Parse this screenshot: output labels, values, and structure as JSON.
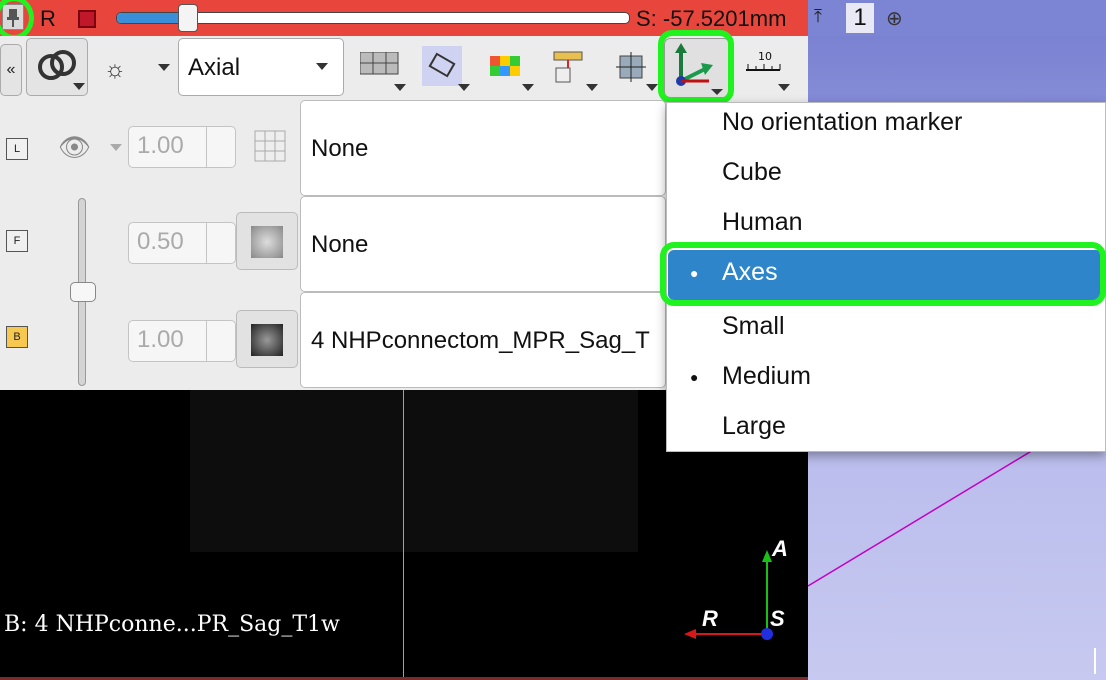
{
  "slice_bar": {
    "view_letter": "R",
    "offset_label": "S: -57.5201mm",
    "slider_position": 0.14,
    "color": "#e8463c"
  },
  "view3d_bar": {
    "view_number": "1",
    "color": "#7c85d4"
  },
  "toolbar": {
    "collapse_label": "«",
    "orientation_value": "Axial",
    "icons": [
      "link-icon",
      "visibility-icon",
      "layout-icon",
      "roi-icon",
      "lut-icon",
      "ruler-icon",
      "crosshair-icon",
      "orientation-marker-icon",
      "ruler-scale-icon"
    ]
  },
  "layers": {
    "label": {
      "badge": "L",
      "opacity": "1.00",
      "volume": "None"
    },
    "foreground": {
      "badge": "F",
      "opacity": "0.50",
      "volume": "None"
    },
    "background": {
      "badge": "B",
      "opacity": "1.00",
      "volume": "4 NHPconnectom_MPR_Sag_T"
    }
  },
  "slice_view": {
    "volume_caption": "B: 4 NHPconne...PR_Sag_T1w",
    "marker_labels": {
      "anterior": "A",
      "right": "R",
      "superior": "S"
    }
  },
  "orientation_menu": {
    "items": [
      {
        "label": "No orientation marker",
        "bullet": ""
      },
      {
        "label": "Cube",
        "bullet": ""
      },
      {
        "label": "Human",
        "bullet": ""
      },
      {
        "label": "Axes",
        "bullet": "●"
      },
      {
        "label": "Small",
        "bullet": ""
      },
      {
        "label": "Medium",
        "bullet": "●"
      },
      {
        "label": "Large",
        "bullet": ""
      }
    ],
    "selected_index": 3,
    "highlight_color": "#2f85c9",
    "annotation_color": "#1ff21f"
  }
}
